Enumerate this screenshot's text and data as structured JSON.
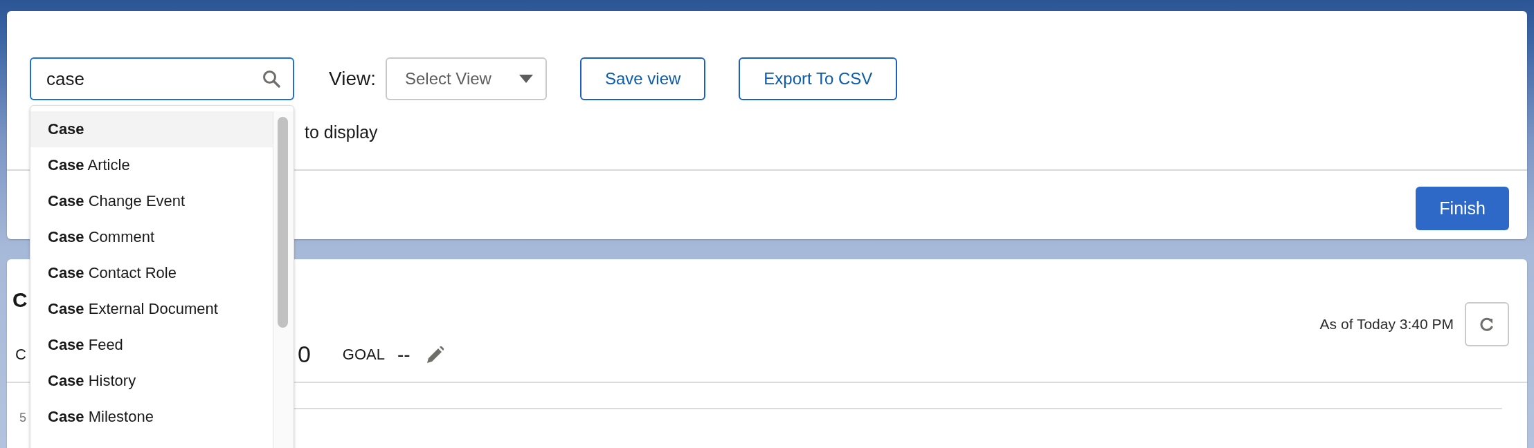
{
  "search": {
    "value": "case"
  },
  "view": {
    "label": "View:",
    "placeholder": "Select View"
  },
  "buttons": [
    {
      "label": "Save view",
      "kind": "outline"
    },
    {
      "label": "Export To CSV",
      "kind": "outline"
    }
  ],
  "info_text": "to display",
  "finish_button": "Finish",
  "dropdown": {
    "items": [
      {
        "text": "**Case**",
        "selected": true
      },
      {
        "text": "**Case** Article",
        "selected": false
      },
      {
        "text": "**Case** Change Event",
        "selected": false
      },
      {
        "text": "**Case** Comment",
        "selected": false
      },
      {
        "text": "**Case** Contact Role",
        "selected": false
      },
      {
        "text": "**Case** External Document",
        "selected": false
      },
      {
        "text": "**Case** Feed",
        "selected": false
      },
      {
        "text": "**Case** History",
        "selected": false
      },
      {
        "text": "**Case** Milestone",
        "selected": false
      }
    ]
  },
  "report": {
    "title": "C",
    "as_of": "As of Today 3:40 PM",
    "metric_label": "C",
    "metric_value": "0",
    "goal_label": "GOAL",
    "goal_value": "--",
    "axis_tick": "5"
  }
}
